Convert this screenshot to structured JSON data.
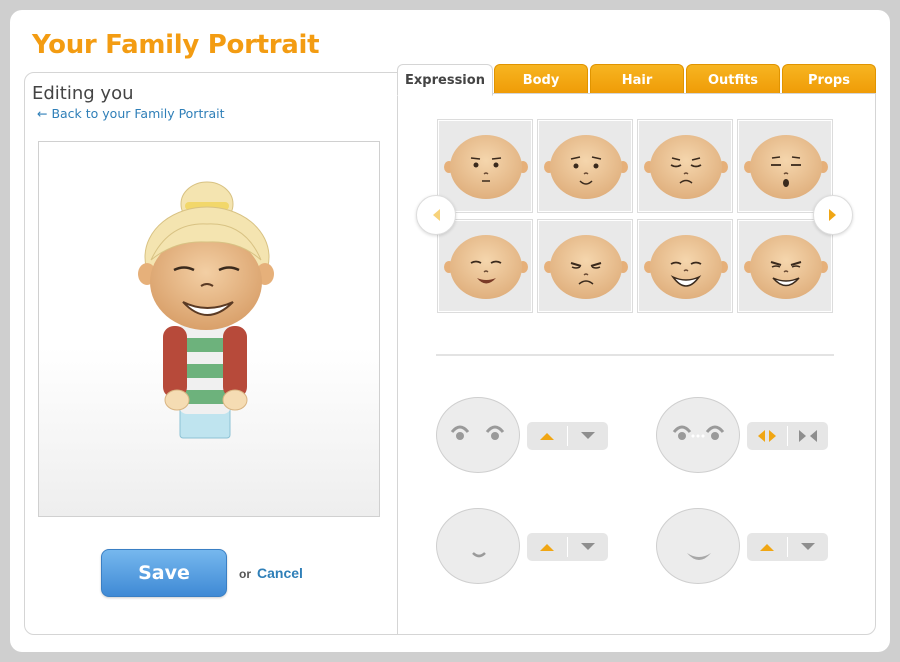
{
  "page": {
    "title": "Your Family Portrait"
  },
  "editor": {
    "heading": "Editing you",
    "back_link": "← Back to your Family Portrait"
  },
  "actions": {
    "save": "Save",
    "or": "or",
    "cancel": "Cancel"
  },
  "tabs": [
    {
      "label": "Expression",
      "active": true
    },
    {
      "label": "Body",
      "active": false
    },
    {
      "label": "Hair",
      "active": false
    },
    {
      "label": "Outfits",
      "active": false
    },
    {
      "label": "Props",
      "active": false
    }
  ],
  "expressions": [
    {
      "name": "neutral"
    },
    {
      "name": "smirk"
    },
    {
      "name": "sleepy"
    },
    {
      "name": "surprised"
    },
    {
      "name": "grin"
    },
    {
      "name": "frown"
    },
    {
      "name": "big-smile"
    },
    {
      "name": "mischievous"
    }
  ],
  "adjusters": [
    {
      "name": "eyes-vertical",
      "icons": [
        "up-arrow-icon",
        "down-arrow-icon"
      ]
    },
    {
      "name": "eyes-spacing",
      "icons": [
        "spread-arrows-icon",
        "squeeze-arrows-icon"
      ]
    },
    {
      "name": "mouth-small-vertical",
      "icons": [
        "up-arrow-icon",
        "down-arrow-icon"
      ]
    },
    {
      "name": "mouth-wide-vertical",
      "icons": [
        "up-arrow-icon",
        "down-arrow-icon"
      ]
    }
  ],
  "colors": {
    "accent": "#f39c12",
    "tab": "#f5a81c",
    "link": "#2f7fb8",
    "save": "#4a93d8",
    "skin": "#f3cfa4"
  }
}
